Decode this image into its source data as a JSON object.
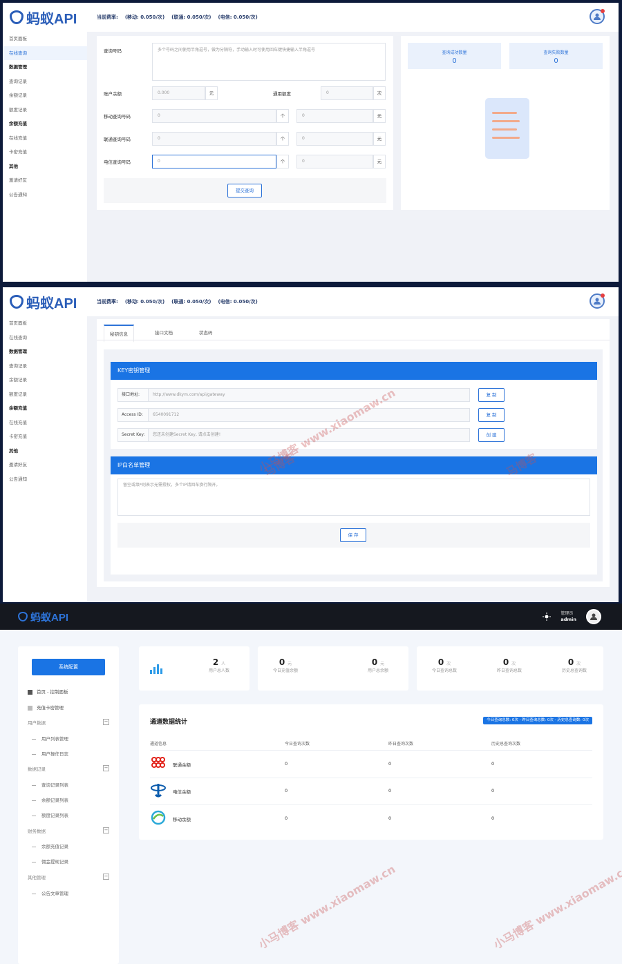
{
  "app": {
    "logo_text": "蚂蚁API"
  },
  "rate": {
    "label": "当前费率:",
    "mobile": "(移动: 0.050/次)",
    "unicom": "(联通: 0.050/次)",
    "telecom": "(电信: 0.050/次)"
  },
  "sidebar": {
    "home": "首页面板",
    "online_query": "在线查询",
    "grp_data": "数据管理",
    "query_records": "查询记录",
    "balance_records": "余额记录",
    "quota_records": "额度记录",
    "grp_recharge": "余额充值",
    "online_recharge": "在线充值",
    "card_recharge": "卡密充值",
    "grp_other": "其他",
    "invite": "邀请好友",
    "notice": "公告通知"
  },
  "query": {
    "numbers_label": "查询号码",
    "numbers_placeholder": "多个号码之间使用半角逗号，做为分隔符，手动输入时可使用回车键快捷输入半角逗号",
    "balance_label": "账户余额",
    "balance_value": "0.000",
    "yuan": "元",
    "quota_label": "通用额度",
    "quota_value": "0",
    "times": "次",
    "mobile_label": "移动查询号码",
    "unicom_label": "联通查询号码",
    "telecom_label": "电信查询号码",
    "zero": "0",
    "arrow": "个",
    "submit": "提交查询",
    "success_count_label": "查询成功数量",
    "fail_count_label": "查询失败数量",
    "success_count": "0",
    "fail_count": "0"
  },
  "key_page": {
    "tabs": [
      "秘钥信息",
      "接口文档",
      "状态码"
    ],
    "key_title": "KEY密钥管理",
    "api_label": "接口地址:",
    "api_value": "http://www.dkym.com/api/gateway",
    "access_label": "Access ID:",
    "access_value": "6540091712",
    "secret_label": "Secret Key:",
    "secret_value": "您还未创建Secret Key, 请点击创建!",
    "copy": "复 制",
    "create": "创 建",
    "ip_title": "IP白名单管理",
    "ip_placeholder": "留空或填*则表示无需授权，多个IP请回车换行隔开。",
    "save": "保 存"
  },
  "admin": {
    "logo_text": "蚂蚁API",
    "role": "管理员",
    "username": "admin",
    "config_btn": "系统配置",
    "menu": {
      "home": "首页 - 控制面板",
      "card": "充值卡密管理",
      "user_grp": "用户数据",
      "user_list": "用户列表管理",
      "user_log": "用户操作日志",
      "record_grp": "数据记录",
      "query_list": "查询记录列表",
      "balance_list": "余额记录列表",
      "quota_list": "额度记录列表",
      "finance_grp": "财务数据",
      "recharge_rec": "余额充值记录",
      "withdraw_rec": "佣金提现记录",
      "other_grp": "其他管理",
      "article": "公告文章管理"
    },
    "stats": {
      "users": "2",
      "users_unit": "人",
      "users_label": "用户总人数",
      "today_recharge": "0",
      "today_recharge_label": "今日充值余额",
      "yuan": "元",
      "user_balance": "0",
      "user_balance_label": "用户总余额",
      "today_query": "0",
      "today_query_label": "今日查询总数",
      "ci": "次",
      "yesterday_query": "0",
      "yesterday_query_label": "昨日查询总数",
      "history_query": "0",
      "history_query_label": "历史总查询数"
    },
    "channel": {
      "title": "通道数据统计",
      "pill": "今日查询总数: 0次 - 昨日查询总数: 0次 - 历史总查询数: 0次",
      "headers": [
        "通道信息",
        "今日查询次数",
        "昨日查询次数",
        "历史总查询次数"
      ],
      "rows": [
        {
          "name": "联通余额",
          "today": "0",
          "yesterday": "0",
          "history": "0"
        },
        {
          "name": "电信余额",
          "today": "0",
          "yesterday": "0",
          "history": "0"
        },
        {
          "name": "移动余额",
          "today": "0",
          "yesterday": "0",
          "history": "0"
        }
      ]
    }
  },
  "watermark": {
    "a": "小马博客 www.xiaomaw.cn",
    "b": "马博客"
  },
  "colors": {
    "brand": "#1a74e4",
    "unicom": "#e2231a",
    "telecom": "#0b5cad",
    "mobile": "#2aa9d8"
  }
}
